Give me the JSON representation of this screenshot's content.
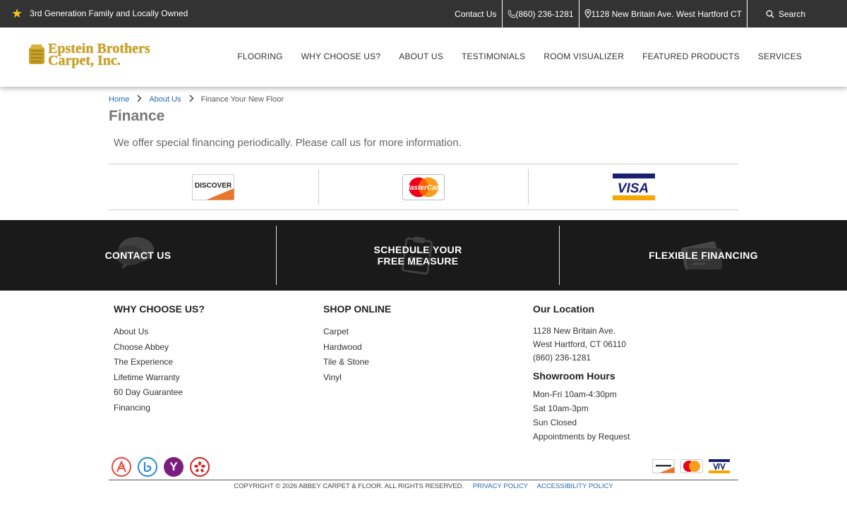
{
  "topbar": {
    "tagline": "3rd Generation Family and Locally Owned",
    "contact": "Contact Us",
    "phone": "(860) 236-1281",
    "address": "1128 New Britain Ave. West Hartford CT",
    "search": "Search"
  },
  "logo": {
    "line1": "Epstein Brothers",
    "line2": "Carpet, Inc."
  },
  "nav": [
    "FLOORING",
    "WHY CHOOSE US?",
    "ABOUT US",
    "TESTIMONIALS",
    "ROOM VISUALIZER",
    "FEATURED PRODUCTS",
    "SERVICES"
  ],
  "breadcrumb": {
    "home": "Home",
    "about": "About Us",
    "current": "Finance Your New Floor"
  },
  "page": {
    "title": "Finance",
    "lead": "We offer special financing periodically. Please call us for more information."
  },
  "cards": {
    "discover": "DISCOVER",
    "mastercard": "MasterCard",
    "visa": "VISA"
  },
  "band": {
    "contact": "CONTACT US",
    "schedule_l1": "SCHEDULE YOUR",
    "schedule_l2": "FREE MEASURE",
    "financing": "FLEXIBLE FINANCING"
  },
  "footer": {
    "why": {
      "title": "WHY CHOOSE US?",
      "items": [
        "About Us",
        "Choose Abbey",
        "The Experience",
        "Lifetime Warranty",
        "60 Day Guarantee",
        "Financing"
      ]
    },
    "shop": {
      "title": "SHOP ONLINE",
      "items": [
        "Carpet",
        "Hardwood",
        "Tile & Stone",
        "Vinyl"
      ]
    },
    "location": {
      "title": "Our Location",
      "address1": "1128 New Britain Ave.",
      "address2": "West Hartford, CT 06110",
      "phone": "(860) 236-1281",
      "hours_title": "Showroom Hours",
      "hours": [
        "Mon-Fri 10am-4:30pm",
        "Sat 10am-3pm",
        "Sun Closed",
        "Appointments by Request"
      ]
    }
  },
  "social": {
    "yahoo_letter": "Y"
  },
  "copyright": {
    "text": "COPYRIGHT © 2026 ABBEY CARPET & FLOOR. ALL RIGHTS RESERVED.",
    "privacy": "PRIVACY POLICY",
    "accessibility": "ACCESSIBILITY POLICY"
  },
  "colors": {
    "topbar_bg": "#333333",
    "band_bg": "#1a1a1a",
    "link": "#2a6aa8",
    "logo_gold": "#c9a227",
    "discover_orange": "#e8752a",
    "mastercard_red": "#eb001b",
    "mastercard_yellow": "#f79e1b",
    "visa_blue": "#1a1f71",
    "visa_gold": "#f7a600"
  }
}
